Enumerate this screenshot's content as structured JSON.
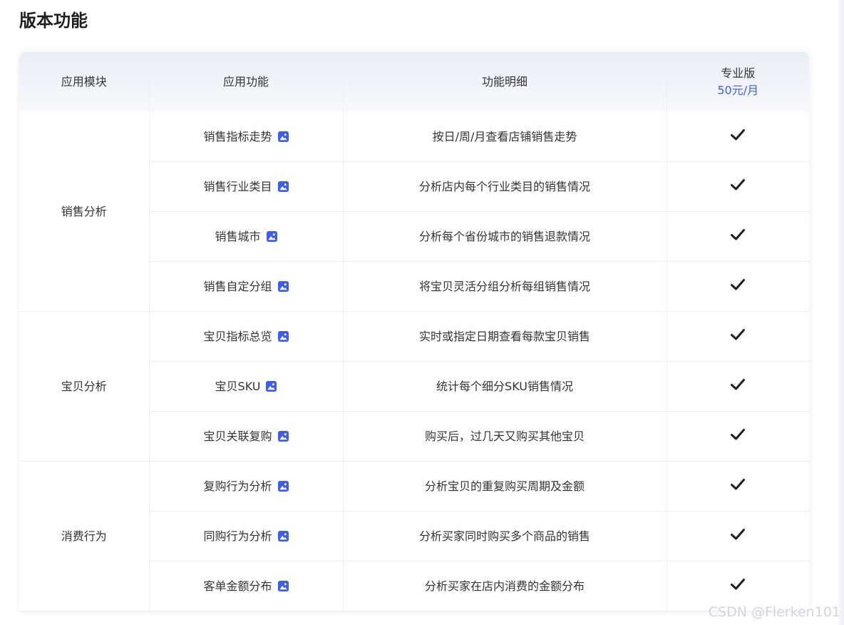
{
  "page": {
    "title": "版本功能"
  },
  "table": {
    "headers": {
      "module": "应用模块",
      "function": "应用功能",
      "detail": "功能明细",
      "edition_name": "专业版",
      "edition_price": "50元/月"
    },
    "groups": [
      {
        "module": "销售分析",
        "rows": [
          {
            "function": "销售指标走势",
            "detail": "按日/周/月查看店铺销售走势",
            "included": true
          },
          {
            "function": "销售行业类目",
            "detail": "分析店内每个行业类目的销售情况",
            "included": true
          },
          {
            "function": "销售城市",
            "detail": "分析每个省份城市的销售退款情况",
            "included": true
          },
          {
            "function": "销售自定分组",
            "detail": "将宝贝灵活分组分析每组销售情况",
            "included": true
          }
        ]
      },
      {
        "module": "宝贝分析",
        "rows": [
          {
            "function": "宝贝指标总览",
            "detail": "实时或指定日期查看每款宝贝销售",
            "included": true
          },
          {
            "function": "宝贝SKU",
            "detail": "统计每个细分SKU销售情况",
            "included": true
          },
          {
            "function": "宝贝关联复购",
            "detail": "购买后，过几天又购买其他宝贝",
            "included": true
          }
        ]
      },
      {
        "module": "消费行为",
        "rows": [
          {
            "function": "复购行为分析",
            "detail": "分析宝贝的重复购买周期及金额",
            "included": true
          },
          {
            "function": "同购行为分析",
            "detail": "分析买家同时购买多个商品的销售",
            "included": true
          },
          {
            "function": "客单金额分布",
            "detail": "分析买家在店内消费的金额分布",
            "included": true
          }
        ]
      }
    ]
  },
  "icons": {
    "function_icon": "image-preview-icon",
    "included_icon": "check-icon"
  },
  "colors": {
    "price": "#3d5df0",
    "icon": "#3d5df0",
    "check": "#1f1f1f"
  },
  "watermark": "CSDN @Flerken101"
}
